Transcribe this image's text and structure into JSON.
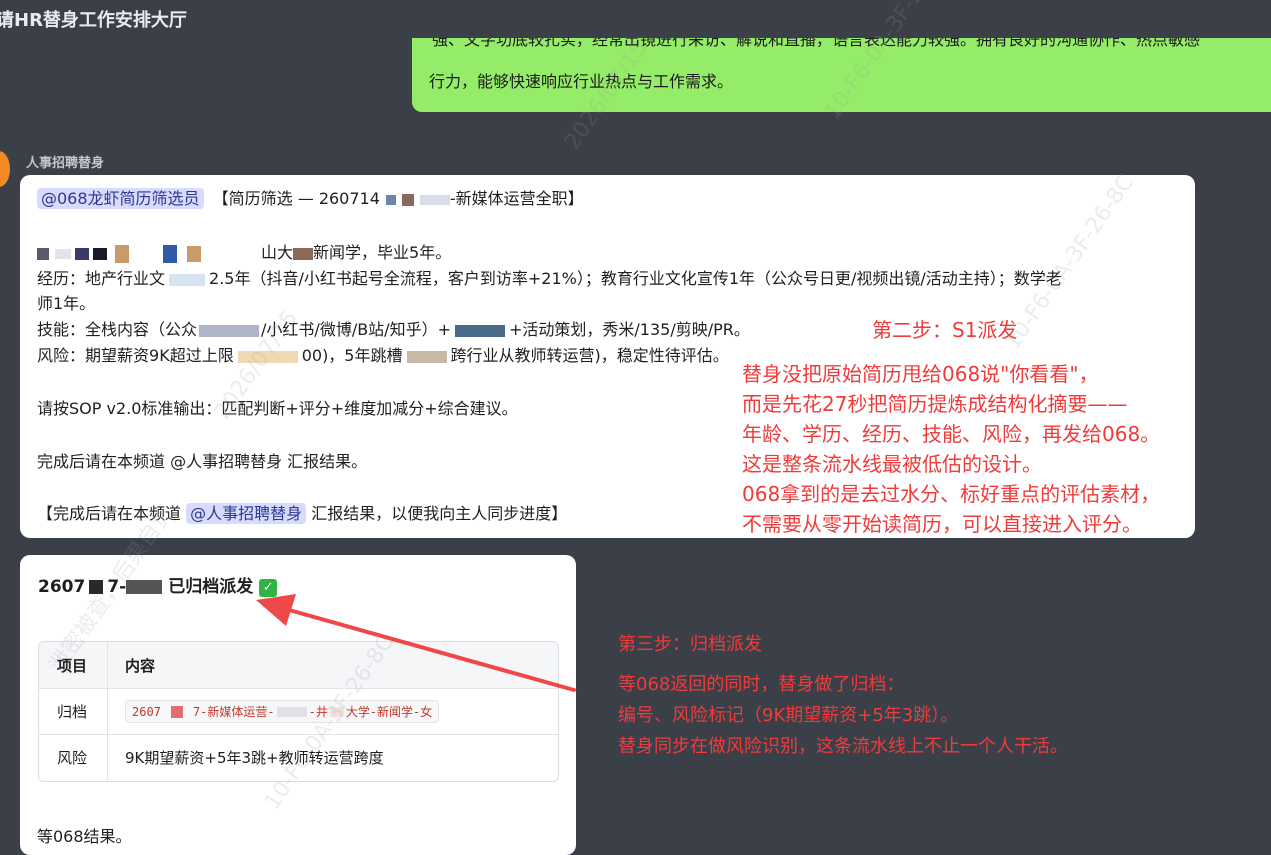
{
  "window": {
    "title": "请HR替身工作安排大厅"
  },
  "prev_message": {
    "line1": "强、文字功底较扎实，经常出镜进行采访、解说和直播，语言表达能力较强。拥有良好的沟通协作、热点敏感",
    "line2": "行力，能够快速响应行业热点与工作需求。"
  },
  "message1": {
    "sender": "人事招聘替身",
    "mention": "@068龙虾简历筛选员",
    "subject_prefix": "【简历筛选 — 260714",
    "subject_suffix": "-新媒体运营全职】",
    "basic_suffix": "山大",
    "basic_end": "新闻学，毕业5年。",
    "exp_label": "经历：",
    "exp_a": "地产行业文",
    "exp_b": "2.5年（抖音/小红书起号全流程，客户到访率+21%）；教育行业文化宣传1年（公众号日更/视频出镜/活动主持）；数学老",
    "exp_c": "师1年。",
    "skill_label": "技能：",
    "skill_a": "全栈内容（公众",
    "skill_b": "/小红书/微博/B站/知乎）+",
    "skill_c": "+活动策划，秀米/135/剪映/PR。",
    "risk_label": "风险：",
    "risk_a": "期望薪资9K超过上限",
    "risk_b": "00)，5年跳槽",
    "risk_c": "跨行业从教师转运营)，稳定性待评估。",
    "instruction": "请按SOP v2.0标准输出：匹配判断+评分+维度加减分+综合建议。",
    "report": "完成后请在本频道 @人事招聘替身 汇报结果。",
    "report2_prefix": "【完成后请在本频道 ",
    "report2_mention": "@人事招聘替身",
    "report2_suffix": " 汇报结果，以便我向主人同步进度】"
  },
  "message2": {
    "title_prefix": "2607",
    "title_mid": "7-",
    "title_suffix": "已归档派发",
    "check": "✓",
    "table": {
      "headers": [
        "项目",
        "内容"
      ],
      "rows": [
        {
          "item": "归档",
          "content_a": "2607",
          "content_b": "7-新媒体运营-",
          "content_c": "-井",
          "content_d": "大学-新闻学-女"
        },
        {
          "item": "风险",
          "content": "9K期望薪资+5年3跳+教师转运营跨度"
        }
      ]
    },
    "footer": "等068结果。"
  },
  "annotations": {
    "step2_title": "第二步：S1派发",
    "step2_lines": [
      "替身没把原始简历甩给068说\"你看看\"，",
      "而是先花27秒把简历提炼成结构化摘要——",
      "年龄、学历、经历、技能、风险，再发给068。",
      "这是整条流水线最被低估的设计。",
      "068拿到的是去过水分、标好重点的评估素材，",
      "不需要从零开始读简历，可以直接进入评分。"
    ],
    "step3_title": "第三步：归档派发",
    "step3_lines": [
      "等068返回的同时，替身做了归档：",
      "编号、风险标记（9K期望薪资+5年3跳）。",
      "替身同步在做风险识别，这条流水线上不止一个人干活。"
    ],
    "color": "#ef3b3b"
  },
  "watermark": {
    "text_a": "2026/07/15",
    "text_b": "10-F6-0A-3F-26-8C",
    "text_c": "泄密被查，后果自负"
  }
}
